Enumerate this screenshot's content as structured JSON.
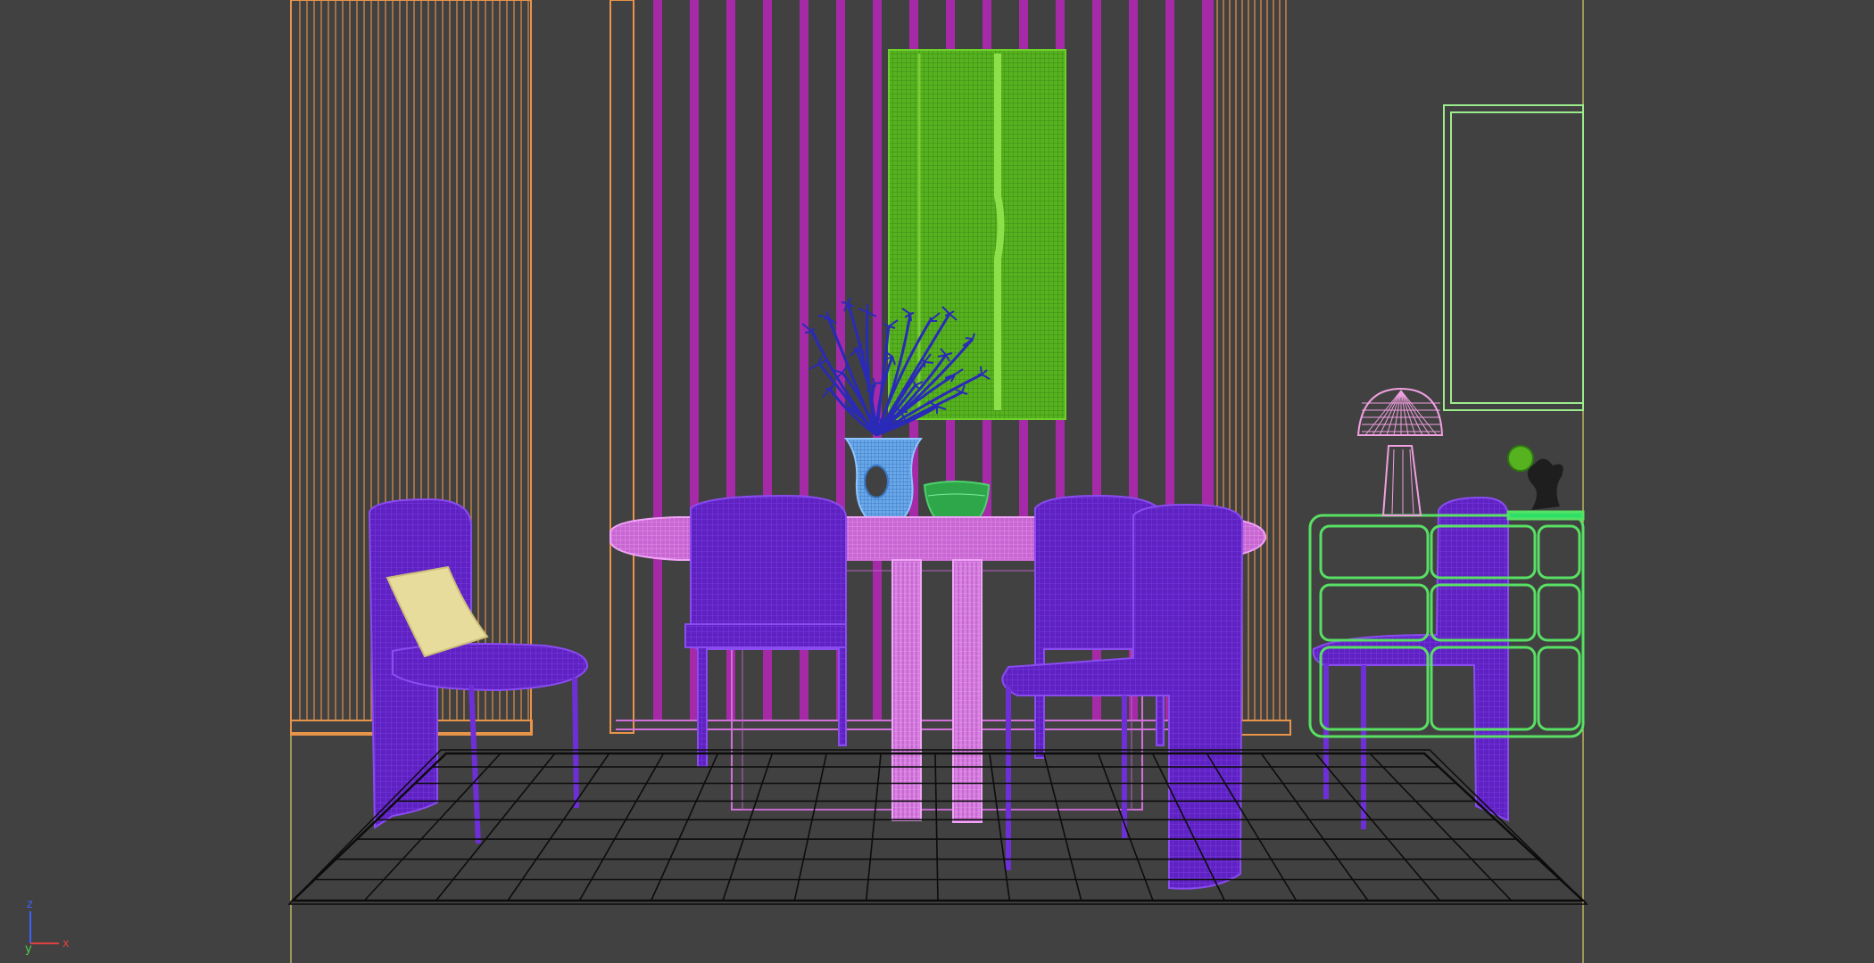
{
  "viewport": {
    "background": "#414141",
    "render_mode": "wireframe",
    "safe_frame_color": "#d8d26a"
  },
  "axis_gizmo": {
    "z_label": "z",
    "y_label": "y",
    "x_label": "x",
    "z_color": "#3f5fff",
    "y_color": "#4cd04c",
    "x_color": "#e04040"
  },
  "scene": {
    "objects": [
      {
        "name": "curtain-left",
        "color": "#e8944a"
      },
      {
        "name": "curtain-center-right",
        "color": "#e8944a"
      },
      {
        "name": "slat-wall",
        "color": "#a62aa8"
      },
      {
        "name": "painting",
        "color": "#56b21f"
      },
      {
        "name": "plant-branches",
        "color": "#2a2ab8"
      },
      {
        "name": "vase",
        "color": "#6aa8e8"
      },
      {
        "name": "bowl",
        "color": "#2ea64a"
      },
      {
        "name": "dining-table",
        "color": "#d070d8"
      },
      {
        "name": "chairs",
        "color": "#6a24c8"
      },
      {
        "name": "cushion",
        "color": "#e8dc9c"
      },
      {
        "name": "sideboard",
        "color": "#58e064"
      },
      {
        "name": "table-lamp",
        "color": "#f0a0e0"
      },
      {
        "name": "wall-frame",
        "color": "#9cec8c"
      },
      {
        "name": "sculpture",
        "color": "#1e1e1e"
      },
      {
        "name": "rug-grid",
        "color": "#111111"
      }
    ]
  }
}
